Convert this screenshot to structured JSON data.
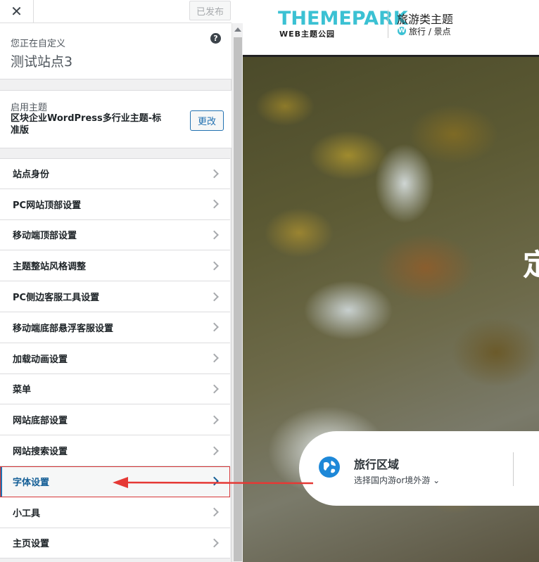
{
  "topbar": {
    "close_glyph": "✕",
    "publish_label": "已发布"
  },
  "customizing": {
    "label": "您正在自定义",
    "site_title": "测试站点3",
    "help_glyph": "?"
  },
  "theme": {
    "label": "启用主题",
    "name": "区块企业WordPress多行业主题-标准版",
    "change_label": "更改"
  },
  "menu": [
    {
      "label": "站点身份"
    },
    {
      "label": "PC网站顶部设置"
    },
    {
      "label": "移动端顶部设置"
    },
    {
      "label": "主题整站风格调整"
    },
    {
      "label": "PC侧边客服工具设置"
    },
    {
      "label": "移动端底部悬浮客服设置"
    },
    {
      "label": "加载动画设置"
    },
    {
      "label": "菜单"
    },
    {
      "label": "网站底部设置"
    },
    {
      "label": "网站搜索设置"
    },
    {
      "label": "字体设置",
      "active": true
    },
    {
      "label": "小工具"
    },
    {
      "label": "主页设置"
    }
  ],
  "preview": {
    "logo": {
      "main": "THEMEPARK",
      "sub": "WEB主题公园"
    },
    "tagline": {
      "title": "旅游类主题",
      "wp_glyph": "W",
      "sub": "旅行 / 景点"
    },
    "hero_char": "定",
    "search_card": {
      "title": "旅行区域",
      "sub": "选择国内游or境外游 ⌄"
    }
  },
  "colors": {
    "accent": "#2271b1",
    "logo": "#3bc1d3",
    "annotation": "#e53935"
  }
}
